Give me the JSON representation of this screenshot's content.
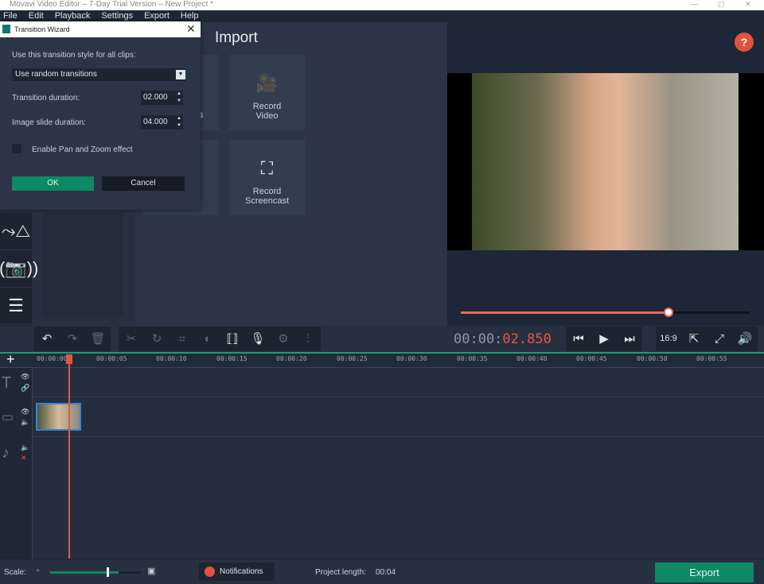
{
  "window": {
    "title": "Movavi Video Editor – 7-Day Trial Version – New Project *"
  },
  "menu": [
    "File",
    "Edit",
    "Playback",
    "Settings",
    "Export",
    "Help"
  ],
  "import": {
    "title": "Import",
    "tiles": [
      {
        "label": "Record Video",
        "icon": "video-camera-icon"
      },
      {
        "label": "Record Screencast",
        "icon": "screencast-icon"
      }
    ],
    "hidden_fragment": "s"
  },
  "dialog": {
    "title": "Transition Wizard",
    "style_label": "Use this transition style for all clips:",
    "style_value": "Use random transitions",
    "transition_duration_label": "Transition duration:",
    "transition_duration": "02.000",
    "image_slide_label": "Image slide duration:",
    "image_slide_duration": "04.000",
    "pan_zoom_label": "Enable Pan and Zoom effect",
    "pan_zoom_checked": false,
    "ok": "OK",
    "cancel": "Cancel"
  },
  "preview": {
    "help": "?",
    "timecode_prefix": "00:00:",
    "timecode_active": "02.850",
    "seek_progress": 0.72,
    "aspect": "16:9"
  },
  "ruler_ticks": [
    "00:00:00",
    "00:00:05",
    "00:00:10",
    "00:00:15",
    "00:00:20",
    "00:00:25",
    "00:00:30",
    "00:00:35",
    "00:00:40",
    "00:00:45",
    "00:00:50",
    "00:00:55"
  ],
  "status": {
    "scale_label": "Scale:",
    "scale_value": 0.75,
    "notifications": "Notifications",
    "project_length_label": "Project length:",
    "project_length": "00:04",
    "export": "Export"
  },
  "colors": {
    "accent": "#0d8a63",
    "playhead": "#e8553d",
    "clip_border": "#2e86de"
  }
}
